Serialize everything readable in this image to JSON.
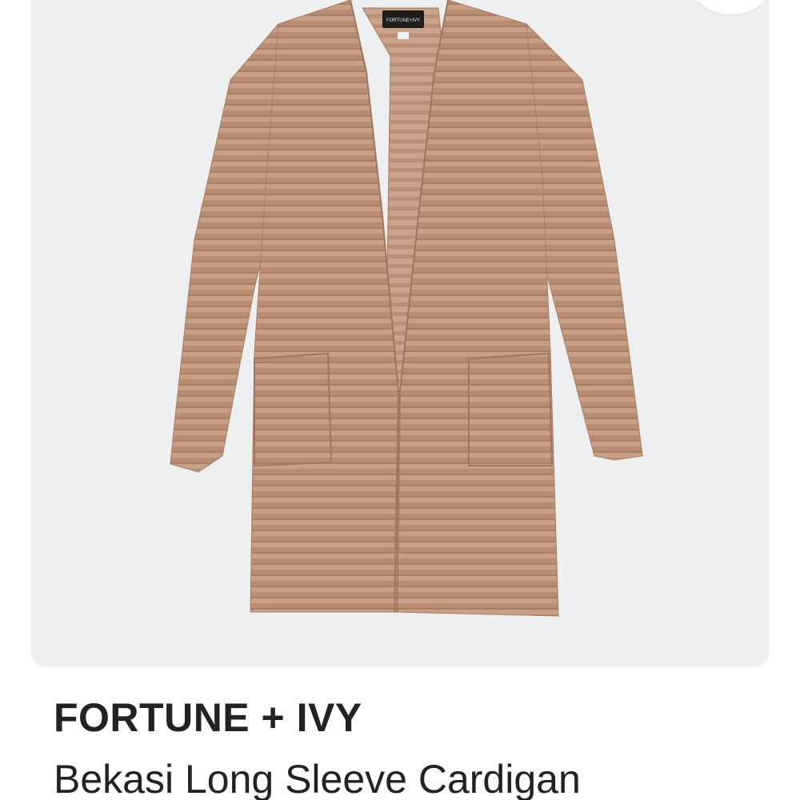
{
  "product": {
    "brand": "FORTUNE + IVY",
    "name": "Bekasi Long Sleeve Cardigan",
    "image": {
      "subject": "camel ribbed long open cardigan",
      "label_text": "FORTUNE+IVY",
      "garment_color": "#c59a7e",
      "background_color": "#eeeff1"
    }
  },
  "actions": {
    "more_label": "···",
    "more_icon": "more-horizontal-icon"
  }
}
